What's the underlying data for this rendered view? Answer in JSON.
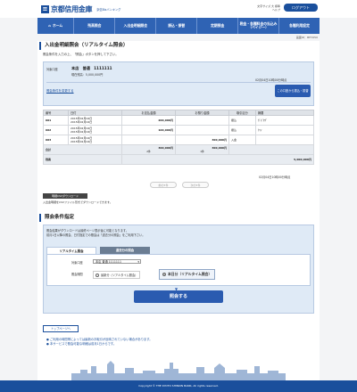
{
  "header": {
    "logo_mark": "≡",
    "bank_name": "京都信用金庫",
    "service_name": "京信Bizバンキング",
    "top_right_lines": [
      "文字サイズ 大 標準",
      "ヘルプ"
    ],
    "logout_label": "ログアウト"
  },
  "nav": {
    "items": [
      "ホーム",
      "残高照会",
      "入出金明細照会",
      "振込・振替",
      "定期預金",
      "税金・各種料金の払込み（ペイジー）",
      "各種利用設定"
    ]
  },
  "screen_id": "画面ID：BHY050",
  "page": {
    "title": "入出金明細照会（リアルタイム照会）",
    "instruction": "照会条件を入力の上、「照会」ボタンを押して下さい。"
  },
  "account": {
    "label_account": "対象口座",
    "account_value": "本店　普通　1111111",
    "label_balance": "現在残高：5,000,000円",
    "change_link": "照会条件を変更する",
    "as_of": "02月04日10時00分時点",
    "other_account_button": "この口座から振込・振替"
  },
  "table": {
    "headers": [
      "番号",
      "日付",
      "お支払金額",
      "お預り金額",
      "取引区分",
      "摘要"
    ],
    "rows": [
      {
        "no": "001",
        "date1": "2015年02月04日",
        "date2": "2015年02月04日",
        "pay": "200,000円",
        "dep": "",
        "kind": "振込",
        "memo": "ｶﾞｽﾞﾀｸﾞ"
      },
      {
        "no": "002",
        "date1": "2015年02月04日",
        "date2": "2015年02月04日",
        "pay": "100,000円",
        "dep": "",
        "kind": "振込",
        "memo": "ｸﾐｲ"
      },
      {
        "no": "003",
        "date1": "2015年02月04日",
        "date2": "2015年02月04日",
        "pay": "",
        "dep": "300,000円",
        "kind": "入金",
        "memo": ""
      }
    ],
    "total_label": "合計",
    "total_pay": "300,000円",
    "total_pay_count": "2件",
    "total_dep": "300,000円",
    "total_dep_count": "1件",
    "balance_label": "残高",
    "balance_value": "5,000,000円",
    "balance_time": "02月04日10時00分時点"
  },
  "pager": {
    "prev": "前の5件",
    "next": "次の5件"
  },
  "download": {
    "button": "明細CSVダウンロード",
    "note": "入出金明細をCSVファイル形式でダウンロードできます。"
  },
  "conditions": {
    "title": "照会条件指定",
    "note1": "照会結果がダウンロードは最終ページ表示後に可能となります。",
    "note2": "前月1日以降の照会、日付指定での照会は「過去分の照会」をご利用下さい。",
    "tab_active": "リアルタイム照会",
    "tab_inactive": "過去分の照会",
    "account_label": "対象口座",
    "account_select": "本店 普通 1111111",
    "period_label": "照会期間",
    "radio1": "最新分（リアルタイム照会）",
    "radio2": "本日分（リアルタイム照会）",
    "query_button": "照会する"
  },
  "footer": {
    "top_link": "トップページへ",
    "note1": "ご利用の時間帯によっては最新のお取引が反映されていない場合があります。",
    "note2": "本サービスで照会可能な明細は前月1日からです。",
    "copyright": "Copyright © THE KYOTO SHINKIN BANK, All rights reserved."
  },
  "colors": {
    "brand": "#1a4f9c",
    "nav": "#2f63b4",
    "light_panel": "#dfeaf6"
  }
}
